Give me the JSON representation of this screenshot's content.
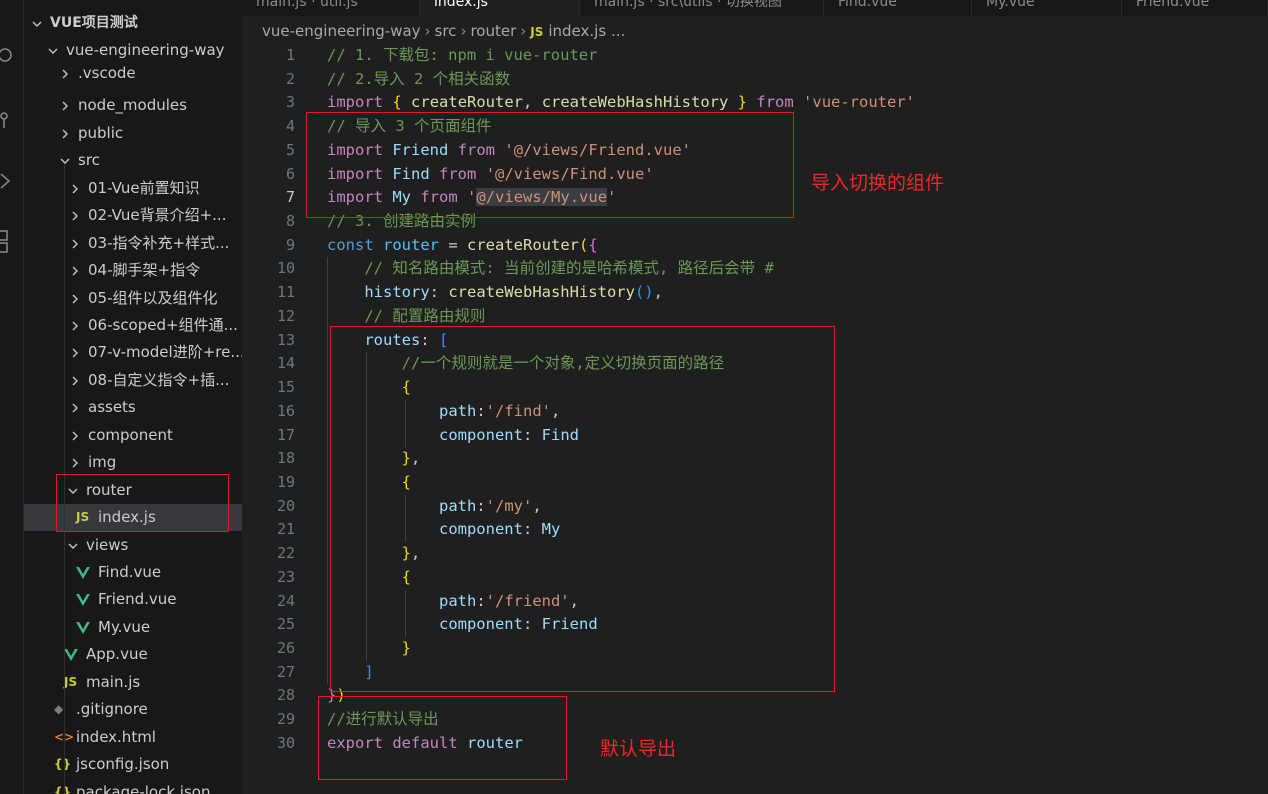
{
  "tabs": [
    {
      "label": "main.js · util.js",
      "active": false
    },
    {
      "label": "index.js",
      "active": true
    },
    {
      "label": "main.js · src\\utils · 切换视图",
      "active": false
    },
    {
      "label": "Find.vue",
      "active": false
    },
    {
      "label": "My.vue",
      "active": false
    },
    {
      "label": "Friend.vue",
      "active": false
    }
  ],
  "breadcrumb": {
    "items": [
      "vue-engineering-way",
      "src",
      "router",
      "index.js",
      "..."
    ],
    "file_icon": "JS"
  },
  "explorer": {
    "root_label": "VUE项目测试",
    "items": [
      {
        "label": "vue-engineering-way",
        "kind": "folder-open"
      },
      {
        "label": ".vscode",
        "kind": "folder"
      },
      {
        "label": "node_modules",
        "kind": "folder"
      },
      {
        "label": "public",
        "kind": "folder"
      },
      {
        "label": "src",
        "kind": "folder-open"
      },
      {
        "label": "01-Vue前置知识",
        "kind": "folder"
      },
      {
        "label": "02-Vue背景介绍+...",
        "kind": "folder"
      },
      {
        "label": "03-指令补充+样式...",
        "kind": "folder"
      },
      {
        "label": "04-脚手架+指令",
        "kind": "folder"
      },
      {
        "label": "05-组件以及组件化",
        "kind": "folder"
      },
      {
        "label": "06-scoped+组件通...",
        "kind": "folder"
      },
      {
        "label": "07-v-model进阶+re...",
        "kind": "folder"
      },
      {
        "label": "08-自定义指令+插...",
        "kind": "folder"
      },
      {
        "label": "assets",
        "kind": "folder"
      },
      {
        "label": "component",
        "kind": "folder"
      },
      {
        "label": "img",
        "kind": "folder"
      },
      {
        "label": "router",
        "kind": "folder-open"
      },
      {
        "label": "index.js",
        "kind": "js"
      },
      {
        "label": "views",
        "kind": "folder-open"
      },
      {
        "label": "Find.vue",
        "kind": "vue"
      },
      {
        "label": "Friend.vue",
        "kind": "vue"
      },
      {
        "label": "My.vue",
        "kind": "vue"
      },
      {
        "label": "App.vue",
        "kind": "vue"
      },
      {
        "label": "main.js",
        "kind": "js"
      },
      {
        "label": ".gitignore",
        "kind": "git"
      },
      {
        "label": "index.html",
        "kind": "html"
      },
      {
        "label": "jsconfig.json",
        "kind": "json"
      },
      {
        "label": "package-lock.json",
        "kind": "json"
      }
    ],
    "icon_glyphs": {
      "js": "JS",
      "json": "{}",
      "html": "<>",
      "git": "◆"
    }
  },
  "editor": {
    "current_line": 7,
    "lines": [
      [
        [
          "c-com",
          "// 1. 下载包: npm i vue-router"
        ]
      ],
      [
        [
          "c-com",
          "// 2.导入 2 个相关函数"
        ]
      ],
      [
        [
          "c-kw",
          "import"
        ],
        [
          "c-pun",
          " "
        ],
        [
          "c-br1",
          "{"
        ],
        [
          "c-pun",
          " "
        ],
        [
          "c-fn",
          "createRouter"
        ],
        [
          "c-pun",
          ", "
        ],
        [
          "c-fn",
          "createWebHashHistory"
        ],
        [
          "c-pun",
          " "
        ],
        [
          "c-br1",
          "}"
        ],
        [
          "c-pun",
          " "
        ],
        [
          "c-kw",
          "from"
        ],
        [
          "c-pun",
          " "
        ],
        [
          "c-str",
          "'vue-router'"
        ]
      ],
      [
        [
          "c-com",
          "// 导入 3 个页面组件"
        ]
      ],
      [
        [
          "c-kw",
          "import"
        ],
        [
          "c-pun",
          " "
        ],
        [
          "c-var",
          "Friend"
        ],
        [
          "c-pun",
          " "
        ],
        [
          "c-kw",
          "from"
        ],
        [
          "c-pun",
          " "
        ],
        [
          "c-str",
          "'@/views/Friend.vue'"
        ]
      ],
      [
        [
          "c-kw",
          "import"
        ],
        [
          "c-pun",
          " "
        ],
        [
          "c-var",
          "Find"
        ],
        [
          "c-pun",
          " "
        ],
        [
          "c-kw",
          "from"
        ],
        [
          "c-pun",
          " "
        ],
        [
          "c-str",
          "'@/views/Find.vue'"
        ]
      ],
      [
        [
          "c-kw",
          "import"
        ],
        [
          "c-pun",
          " "
        ],
        [
          "c-var",
          "My"
        ],
        [
          "c-pun",
          " "
        ],
        [
          "c-kw",
          "from"
        ],
        [
          "c-pun",
          " "
        ],
        [
          "c-str",
          "'"
        ],
        [
          "c-str hl",
          "@/views/My.vue"
        ],
        [
          "c-str",
          "'"
        ]
      ],
      [
        [
          "c-com",
          "// 3. 创建路由实例"
        ]
      ],
      [
        [
          "c-kw2",
          "const"
        ],
        [
          "c-pun",
          " "
        ],
        [
          "c-cls",
          "router"
        ],
        [
          "c-pun",
          " = "
        ],
        [
          "c-fn",
          "createRouter"
        ],
        [
          "c-br1",
          "("
        ],
        [
          "c-br2",
          "{"
        ]
      ],
      [
        [
          "c-pun",
          "    "
        ],
        [
          "c-com",
          "// 知名路由模式: 当前创建的是哈希模式, 路径后会带 #"
        ]
      ],
      [
        [
          "c-pun",
          "    "
        ],
        [
          "c-var",
          "history"
        ],
        [
          "c-pun",
          ": "
        ],
        [
          "c-fn",
          "createWebHashHistory"
        ],
        [
          "c-br3",
          "()"
        ],
        [
          "c-pun",
          ","
        ]
      ],
      [
        [
          "c-pun",
          "    "
        ],
        [
          "c-com",
          "// 配置路由规则"
        ]
      ],
      [
        [
          "c-pun",
          "    "
        ],
        [
          "c-var",
          "routes"
        ],
        [
          "c-pun",
          ": "
        ],
        [
          "c-br3",
          "["
        ]
      ],
      [
        [
          "c-pun",
          "        "
        ],
        [
          "c-com",
          "//一个规则就是一个对象,定义切换页面的路径"
        ]
      ],
      [
        [
          "c-pun",
          "        "
        ],
        [
          "c-br1",
          "{"
        ]
      ],
      [
        [
          "c-pun",
          "            "
        ],
        [
          "c-var",
          "path"
        ],
        [
          "c-pun",
          ":"
        ],
        [
          "c-str",
          "'/find'"
        ],
        [
          "c-pun",
          ","
        ]
      ],
      [
        [
          "c-pun",
          "            "
        ],
        [
          "c-var",
          "component"
        ],
        [
          "c-pun",
          ": "
        ],
        [
          "c-var",
          "Find"
        ]
      ],
      [
        [
          "c-pun",
          "        "
        ],
        [
          "c-br1",
          "}"
        ],
        [
          "c-pun",
          ","
        ]
      ],
      [
        [
          "c-pun",
          "        "
        ],
        [
          "c-br1",
          "{"
        ]
      ],
      [
        [
          "c-pun",
          "            "
        ],
        [
          "c-var",
          "path"
        ],
        [
          "c-pun",
          ":"
        ],
        [
          "c-str",
          "'/my'"
        ],
        [
          "c-pun",
          ","
        ]
      ],
      [
        [
          "c-pun",
          "            "
        ],
        [
          "c-var",
          "component"
        ],
        [
          "c-pun",
          ": "
        ],
        [
          "c-var",
          "My"
        ]
      ],
      [
        [
          "c-pun",
          "        "
        ],
        [
          "c-br1",
          "}"
        ],
        [
          "c-pun",
          ","
        ]
      ],
      [
        [
          "c-pun",
          "        "
        ],
        [
          "c-br1",
          "{"
        ]
      ],
      [
        [
          "c-pun",
          "            "
        ],
        [
          "c-var",
          "path"
        ],
        [
          "c-pun",
          ":"
        ],
        [
          "c-str",
          "'/friend'"
        ],
        [
          "c-pun",
          ","
        ]
      ],
      [
        [
          "c-pun",
          "            "
        ],
        [
          "c-var",
          "component"
        ],
        [
          "c-pun",
          ": "
        ],
        [
          "c-var",
          "Friend"
        ]
      ],
      [
        [
          "c-pun",
          "        "
        ],
        [
          "c-br1",
          "}"
        ]
      ],
      [
        [
          "c-pun",
          "    "
        ],
        [
          "c-br3",
          "]"
        ]
      ],
      [
        [
          "c-br2",
          "}"
        ],
        [
          "c-br1",
          ")"
        ]
      ],
      [
        [
          "c-com",
          "//进行默认导出"
        ]
      ],
      [
        [
          "c-kw",
          "export"
        ],
        [
          "c-pun",
          " "
        ],
        [
          "c-kw",
          "default"
        ],
        [
          "c-pun",
          " "
        ],
        [
          "c-var",
          "router"
        ]
      ]
    ]
  },
  "annotations": {
    "import_components": "导入切换的组件",
    "default_export": "默认导出"
  },
  "colors": {
    "annotation_red": "#e01b1b",
    "vue_green": "#41b883",
    "js_yellow": "#cbcb41"
  }
}
